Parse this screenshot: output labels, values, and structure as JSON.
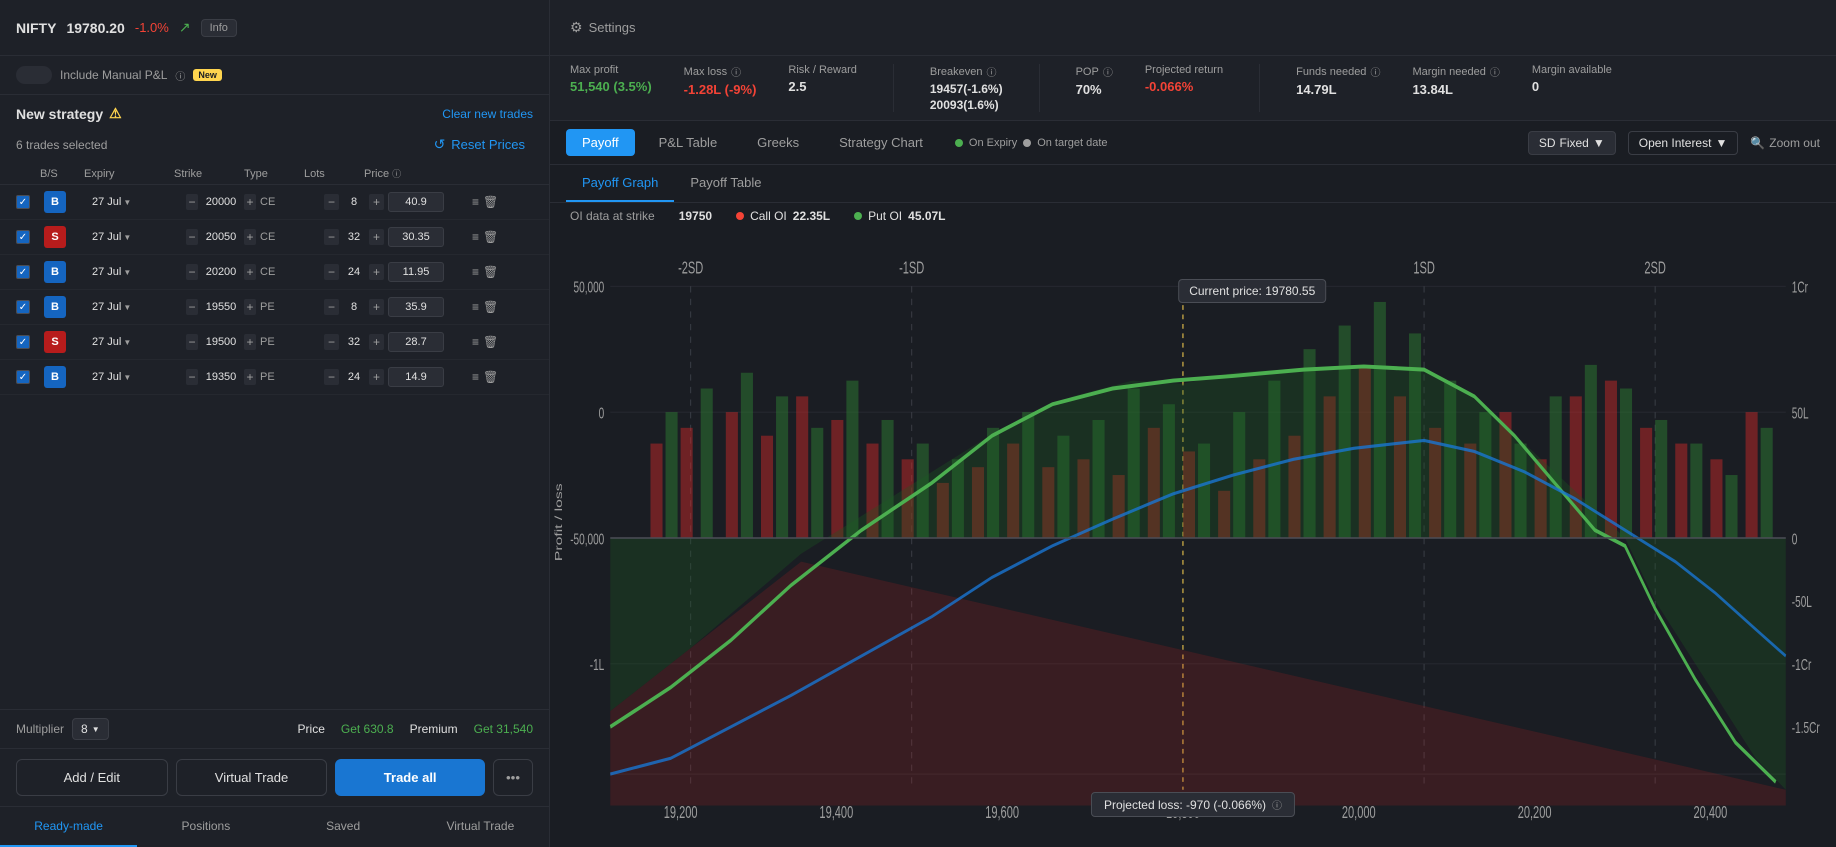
{
  "header": {
    "instrument": "NIFTY",
    "price": "19780.20",
    "change": "-1.0%",
    "info_label": "Info",
    "settings_label": "Settings"
  },
  "toggle": {
    "label": "Include Manual P&L",
    "badge": "New"
  },
  "strategy": {
    "title": "New strategy",
    "trades_selected": "6 trades selected",
    "clear_label": "Clear new trades",
    "reset_prices_label": "Reset Prices"
  },
  "table": {
    "headers": [
      "",
      "B/S",
      "Expiry",
      "Strike",
      "Type",
      "Lots",
      "Price",
      ""
    ],
    "rows": [
      {
        "bs": "B",
        "expiry": "27 Jul",
        "strike": "20000",
        "type": "CE",
        "lots": "8",
        "price": "40.9"
      },
      {
        "bs": "S",
        "expiry": "27 Jul",
        "strike": "20050",
        "type": "CE",
        "lots": "32",
        "price": "30.35"
      },
      {
        "bs": "B",
        "expiry": "27 Jul",
        "strike": "20200",
        "type": "CE",
        "lots": "24",
        "price": "11.95"
      },
      {
        "bs": "B",
        "expiry": "27 Jul",
        "strike": "19550",
        "type": "PE",
        "lots": "8",
        "price": "35.9"
      },
      {
        "bs": "S",
        "expiry": "27 Jul",
        "strike": "19500",
        "type": "PE",
        "lots": "32",
        "price": "28.7"
      },
      {
        "bs": "B",
        "expiry": "27 Jul",
        "strike": "19350",
        "type": "PE",
        "lots": "24",
        "price": "14.9"
      }
    ]
  },
  "multiplier": {
    "label": "Multiplier",
    "value": "8",
    "price_label": "Price",
    "price_value": "Get 630.8",
    "premium_label": "Premium",
    "premium_value": "Get 31,540"
  },
  "action_buttons": {
    "add_edit": "Add / Edit",
    "virtual_trade": "Virtual Trade",
    "trade_all": "Trade all"
  },
  "bottom_tabs": [
    "Ready-made",
    "Positions",
    "Saved",
    "Virtual Trade"
  ],
  "stats": {
    "max_profit_label": "Max profit",
    "max_profit_value": "51,540 (3.5%)",
    "max_loss_label": "Max loss",
    "max_loss_value": "-1.28L (-9%)",
    "risk_reward_label": "Risk / Reward",
    "risk_reward_value": "2.5",
    "breakeven_label": "Breakeven",
    "breakeven_val1": "19457(-1.6%)",
    "breakeven_val2": "20093(1.6%)",
    "pop_label": "POP",
    "pop_value": "70%",
    "projected_return_label": "Projected return",
    "projected_return_value": "-0.066%",
    "funds_needed_label": "Funds needed",
    "funds_needed_value": "14.79L",
    "margin_needed_label": "Margin needed",
    "margin_needed_value": "13.84L",
    "margin_available_label": "Margin available",
    "margin_available_value": "0"
  },
  "chart_tabs": {
    "payoff": "Payoff",
    "pl_table": "P&L Table",
    "greeks": "Greeks",
    "strategy_chart": "Strategy Chart"
  },
  "legend": {
    "on_expiry": "On Expiry",
    "on_target": "On target date"
  },
  "toolbar": {
    "sd_label": "SD",
    "sd_value": "Fixed",
    "oi_label": "Open Interest",
    "zoom_label": "Zoom out"
  },
  "sub_tabs": {
    "payoff_graph": "Payoff Graph",
    "payoff_table": "Payoff Table"
  },
  "oi_bar": {
    "label": "OI data at strike",
    "strike": "19750",
    "call_label": "Call OI",
    "call_value": "22.35L",
    "put_label": "Put OI",
    "put_value": "45.07L"
  },
  "chart": {
    "current_price_label": "Current price: 19780.55",
    "sd_labels": [
      "-2SD",
      "-1SD",
      "1SD",
      "2SD"
    ],
    "x_labels": [
      "19,200",
      "19,400",
      "19,600",
      "19,800",
      "20,000",
      "20,200",
      "20,400"
    ],
    "y_left_labels": [
      "50,000",
      "0",
      "-50,000",
      "-1L"
    ],
    "y_right_labels": [
      "1Cr",
      "50L",
      "0",
      "-50L",
      "-1Cr",
      "-1.5Cr"
    ],
    "projected_loss": "Projected loss: -970 (-0.066%)"
  }
}
